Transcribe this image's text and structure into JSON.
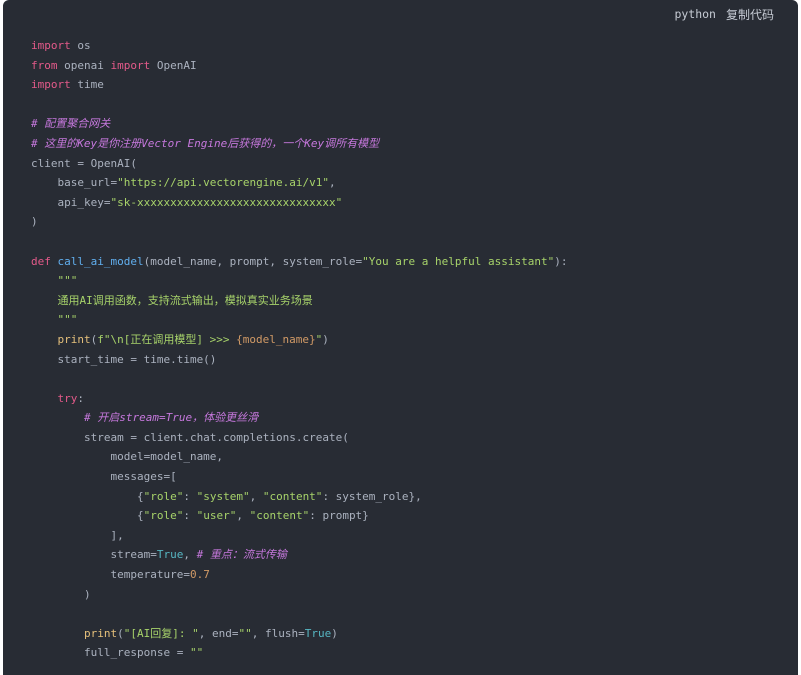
{
  "toolbar": {
    "language": "python",
    "copy_label": "复制代码"
  },
  "colors": {
    "background": "#282c34",
    "keyword": "#e45a8a",
    "string": "#a7d36a",
    "comment": "#c678dd",
    "function": "#61afef",
    "builtin": "#e5c07b",
    "constant": "#56b6c2",
    "number": "#d19a66"
  },
  "code_lines": [
    [
      {
        "t": "keyword",
        "v": "import"
      },
      {
        "t": "plain",
        "v": " os"
      }
    ],
    [
      {
        "t": "keyword",
        "v": "from"
      },
      {
        "t": "plain",
        "v": " openai "
      },
      {
        "t": "keyword",
        "v": "import"
      },
      {
        "t": "plain",
        "v": " OpenAI"
      }
    ],
    [
      {
        "t": "keyword",
        "v": "import"
      },
      {
        "t": "plain",
        "v": " time"
      }
    ],
    [],
    [
      {
        "t": "comment",
        "v": "# 配置聚合网关"
      }
    ],
    [
      {
        "t": "comment",
        "v": "# 这里的Key是你注册Vector Engine后获得的，一个Key调所有模型"
      }
    ],
    [
      {
        "t": "plain",
        "v": "client = OpenAI("
      }
    ],
    [
      {
        "t": "plain",
        "v": "    base_url="
      },
      {
        "t": "string",
        "v": "\"https://api.vectorengine.ai/v1\""
      },
      {
        "t": "plain",
        "v": ","
      }
    ],
    [
      {
        "t": "plain",
        "v": "    api_key="
      },
      {
        "t": "string",
        "v": "\"sk-xxxxxxxxxxxxxxxxxxxxxxxxxxxxxx\""
      }
    ],
    [
      {
        "t": "plain",
        "v": ")"
      }
    ],
    [],
    [
      {
        "t": "keyword",
        "v": "def"
      },
      {
        "t": "plain",
        "v": " "
      },
      {
        "t": "func",
        "v": "call_ai_model"
      },
      {
        "t": "plain",
        "v": "(model_name, prompt, system_role="
      },
      {
        "t": "string",
        "v": "\"You are a helpful assistant\""
      },
      {
        "t": "plain",
        "v": "):"
      }
    ],
    [
      {
        "t": "string",
        "v": "    \"\"\""
      }
    ],
    [
      {
        "t": "string",
        "v": "    通用AI调用函数，支持流式输出，模拟真实业务场景"
      }
    ],
    [
      {
        "t": "string",
        "v": "    \"\"\""
      }
    ],
    [
      {
        "t": "plain",
        "v": "    "
      },
      {
        "t": "builtin",
        "v": "print"
      },
      {
        "t": "plain",
        "v": "("
      },
      {
        "t": "string",
        "v": "f\"\\n[正在调用模型] >>> "
      },
      {
        "t": "interp",
        "v": "{model_name}"
      },
      {
        "t": "string",
        "v": "\""
      },
      {
        "t": "plain",
        "v": ")"
      }
    ],
    [
      {
        "t": "plain",
        "v": "    start_time = time.time()"
      }
    ],
    [],
    [
      {
        "t": "plain",
        "v": "    "
      },
      {
        "t": "keyword",
        "v": "try"
      },
      {
        "t": "plain",
        "v": ":"
      }
    ],
    [
      {
        "t": "plain",
        "v": "        "
      },
      {
        "t": "comment",
        "v": "# 开启stream=True，体验更丝滑"
      }
    ],
    [
      {
        "t": "plain",
        "v": "        stream = client.chat.completions.create("
      }
    ],
    [
      {
        "t": "plain",
        "v": "            model=model_name,"
      }
    ],
    [
      {
        "t": "plain",
        "v": "            messages=["
      }
    ],
    [
      {
        "t": "plain",
        "v": "                {"
      },
      {
        "t": "string",
        "v": "\"role\""
      },
      {
        "t": "plain",
        "v": ": "
      },
      {
        "t": "string",
        "v": "\"system\""
      },
      {
        "t": "plain",
        "v": ", "
      },
      {
        "t": "string",
        "v": "\"content\""
      },
      {
        "t": "plain",
        "v": ": system_role},"
      }
    ],
    [
      {
        "t": "plain",
        "v": "                {"
      },
      {
        "t": "string",
        "v": "\"role\""
      },
      {
        "t": "plain",
        "v": ": "
      },
      {
        "t": "string",
        "v": "\"user\""
      },
      {
        "t": "plain",
        "v": ", "
      },
      {
        "t": "string",
        "v": "\"content\""
      },
      {
        "t": "plain",
        "v": ": prompt}"
      }
    ],
    [
      {
        "t": "plain",
        "v": "            ],"
      }
    ],
    [
      {
        "t": "plain",
        "v": "            stream="
      },
      {
        "t": "const",
        "v": "True"
      },
      {
        "t": "plain",
        "v": ", "
      },
      {
        "t": "comment",
        "v": "# 重点：流式传输"
      }
    ],
    [
      {
        "t": "plain",
        "v": "            temperature="
      },
      {
        "t": "number",
        "v": "0.7"
      }
    ],
    [
      {
        "t": "plain",
        "v": "        )"
      }
    ],
    [],
    [
      {
        "t": "plain",
        "v": "        "
      },
      {
        "t": "builtin",
        "v": "print"
      },
      {
        "t": "plain",
        "v": "("
      },
      {
        "t": "string",
        "v": "\"[AI回复]: \""
      },
      {
        "t": "plain",
        "v": ", end="
      },
      {
        "t": "string",
        "v": "\"\""
      },
      {
        "t": "plain",
        "v": ", flush="
      },
      {
        "t": "const",
        "v": "True"
      },
      {
        "t": "plain",
        "v": ")"
      }
    ],
    [
      {
        "t": "plain",
        "v": "        full_response = "
      },
      {
        "t": "string",
        "v": "\"\""
      }
    ]
  ]
}
